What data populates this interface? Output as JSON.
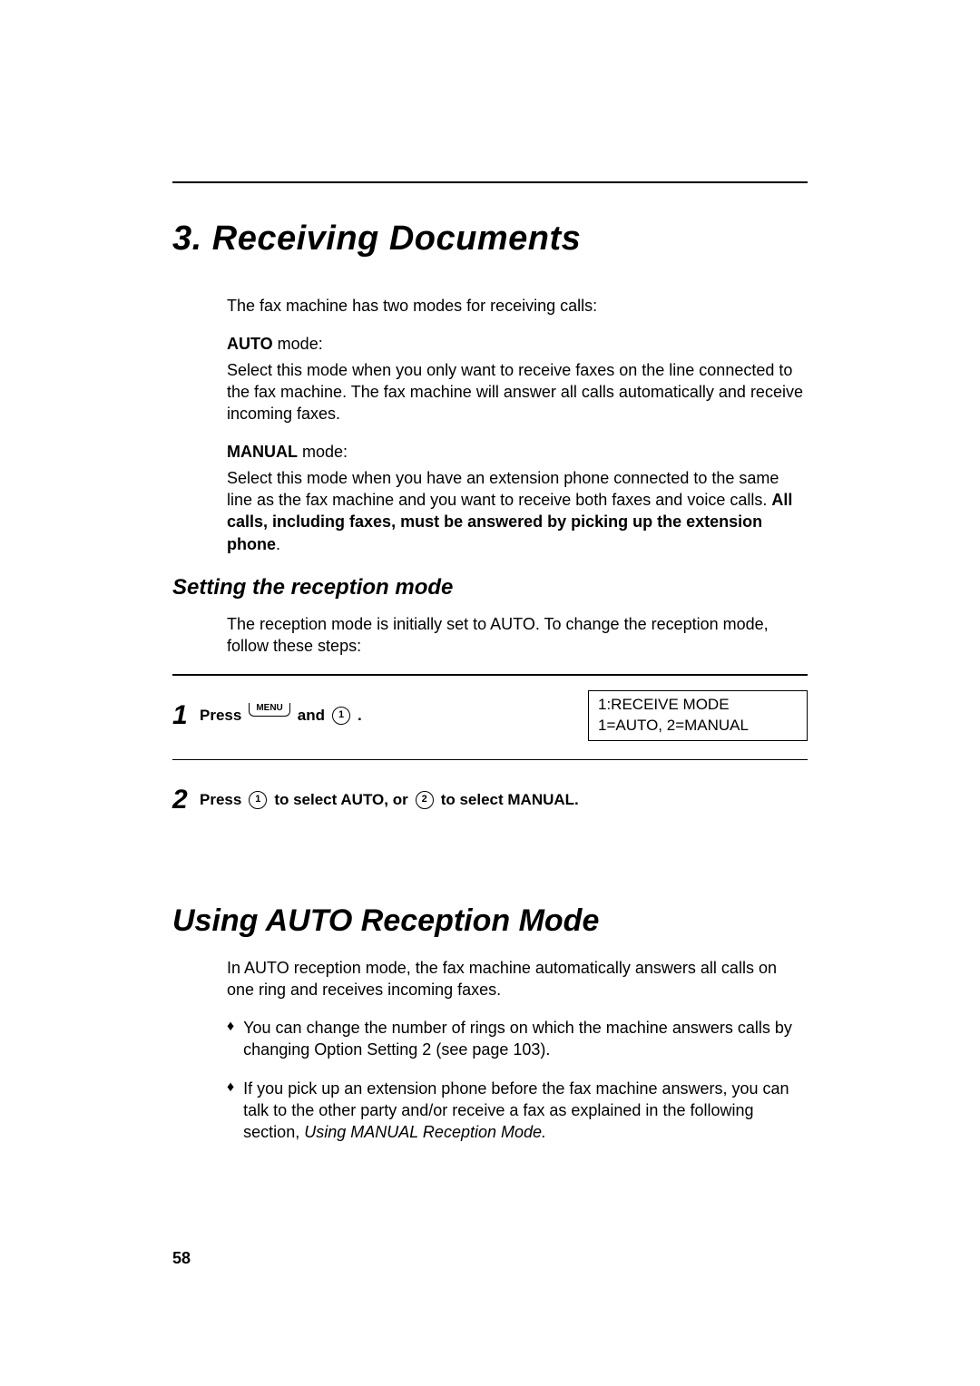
{
  "chapter_title": "3.  Receiving Documents",
  "intro": "The fax machine has two modes for receiving calls:",
  "auto_mode_label": "AUTO",
  "auto_mode_suffix": " mode:",
  "auto_mode_desc": "Select this mode when you only want to receive faxes on the line connected to the fax machine. The fax machine will answer all calls automatically and receive incoming faxes.",
  "manual_mode_label": "MANUAL",
  "manual_mode_suffix": " mode:",
  "manual_mode_desc_part1": "Select this mode when you have an extension phone connected to the same line as the fax machine and you want to receive both faxes and voice calls. ",
  "manual_mode_desc_bold": "All calls, including faxes, must be answered by picking up the extension phone",
  "manual_mode_desc_part2": ".",
  "section1_title": "Setting the reception mode",
  "section1_intro": "The reception mode is initially set to AUTO. To change the reception mode, follow these steps:",
  "step1_num": "1",
  "step1_press": "Press ",
  "step1_menu": "MENU",
  "step1_and": " and ",
  "step1_key1": "1",
  "step1_period": " .",
  "lcd_line1": "1:RECEIVE MODE",
  "lcd_line2": "1=AUTO, 2=MANUAL",
  "step2_num": "2",
  "step2_press": "Press ",
  "step2_key1": "1",
  "step2_mid": " to select AUTO, or ",
  "step2_key2": "2",
  "step2_end": " to select MANUAL.",
  "section2_title": "Using AUTO Reception Mode",
  "section2_intro": "In AUTO reception mode, the fax machine automatically answers all calls on one ring and receives incoming faxes.",
  "bullet1": "You can change the number of rings on which the machine answers calls by changing Option Setting 2 (see page 103).",
  "bullet2_part1": "If you pick up an extension phone before the fax machine answers, you can talk to the other party and/or receive a fax as explained in the following section, ",
  "bullet2_italic": "Using MANUAL Reception Mode.",
  "page_number": "58"
}
